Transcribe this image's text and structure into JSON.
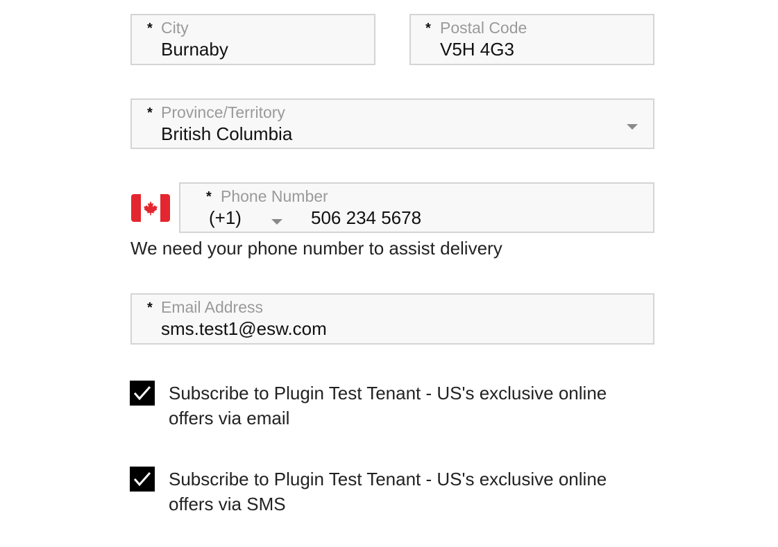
{
  "form": {
    "city": {
      "label": "City",
      "value": "Burnaby",
      "required_mark": "*"
    },
    "postal_code": {
      "label": "Postal Code",
      "value": "V5H 4G3",
      "required_mark": "*"
    },
    "province": {
      "label": "Province/Territory",
      "value": "British Columbia",
      "required_mark": "*"
    },
    "phone": {
      "label": "Phone Number",
      "required_mark": "*",
      "country_code": "(+1)",
      "value": "506 234 5678",
      "hint": "We need your phone number to assist delivery",
      "flag_icon": "canada-flag-icon"
    },
    "email": {
      "label": "Email Address",
      "value": "sms.test1@esw.com",
      "required_mark": "*"
    },
    "subscriptions": [
      {
        "label": "Subscribe to Plugin Test Tenant - US's exclusive online offers via email",
        "checked": true
      },
      {
        "label": "Subscribe to Plugin Test Tenant - US's exclusive online offers via SMS",
        "checked": true
      }
    ]
  },
  "colors": {
    "field_background": "#f8f8f8",
    "field_border": "#d4d4d4",
    "label_gray": "#9a9a9a",
    "checkbox_fill": "#000000",
    "flag_red": "#e3262f"
  }
}
